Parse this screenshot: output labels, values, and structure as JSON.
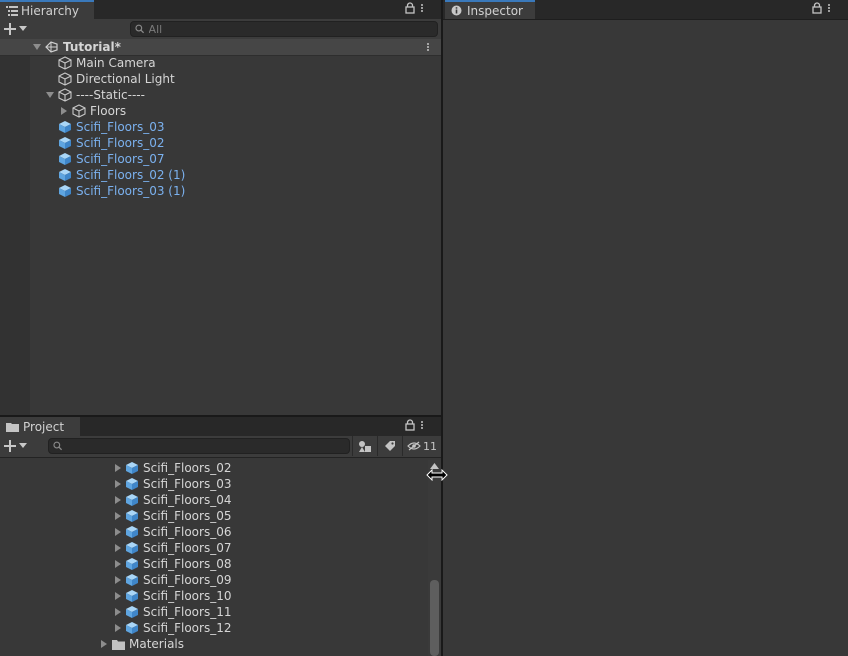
{
  "hierarchy": {
    "tab_label": "Hierarchy",
    "search_placeholder": "All",
    "scene_name": "Tutorial*",
    "items": [
      {
        "label": "Main Camera",
        "style": "white"
      },
      {
        "label": "Directional Light",
        "style": "white"
      },
      {
        "label": "----Static----",
        "style": "white"
      },
      {
        "label": "Floors",
        "style": "white"
      },
      {
        "label": "Scifi_Floors_03",
        "style": "blue"
      },
      {
        "label": "Scifi_Floors_02",
        "style": "blue"
      },
      {
        "label": "Scifi_Floors_07",
        "style": "blue"
      },
      {
        "label": "Scifi_Floors_02 (1)",
        "style": "blue"
      },
      {
        "label": "Scifi_Floors_03 (1)",
        "style": "blue"
      }
    ]
  },
  "inspector": {
    "tab_label": "Inspector"
  },
  "project": {
    "tab_label": "Project",
    "hidden_count": "11",
    "items": [
      {
        "label": "Scifi_Floors_02"
      },
      {
        "label": "Scifi_Floors_03"
      },
      {
        "label": "Scifi_Floors_04"
      },
      {
        "label": "Scifi_Floors_05"
      },
      {
        "label": "Scifi_Floors_06"
      },
      {
        "label": "Scifi_Floors_07"
      },
      {
        "label": "Scifi_Floors_08"
      },
      {
        "label": "Scifi_Floors_09"
      },
      {
        "label": "Scifi_Floors_10"
      },
      {
        "label": "Scifi_Floors_11"
      },
      {
        "label": "Scifi_Floors_12"
      }
    ],
    "folder_label": "Materials"
  },
  "colors": {
    "accent_blue": "#7bb1ef",
    "panel_bg": "#383838",
    "tab_active_border": "#3a79bb"
  }
}
